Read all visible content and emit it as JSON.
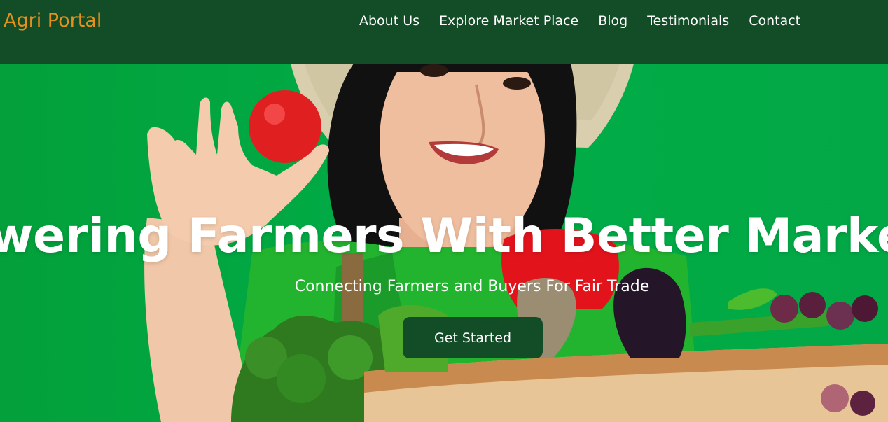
{
  "navbar": {
    "brand": "Agri Portal",
    "links": [
      "About Us",
      "Explore Market Place",
      "Blog",
      "Testimonials",
      "Contact"
    ]
  },
  "hero": {
    "headline": "owering Farmers With Better Market",
    "subheadline": "Connecting Farmers and Buyers For Fair Trade",
    "cta_label": "Get Started"
  },
  "colors": {
    "navbar_bg": "#134d28",
    "brand": "#e4901c",
    "hero_bg": "#00ad47",
    "cta_bg": "#134d28"
  }
}
